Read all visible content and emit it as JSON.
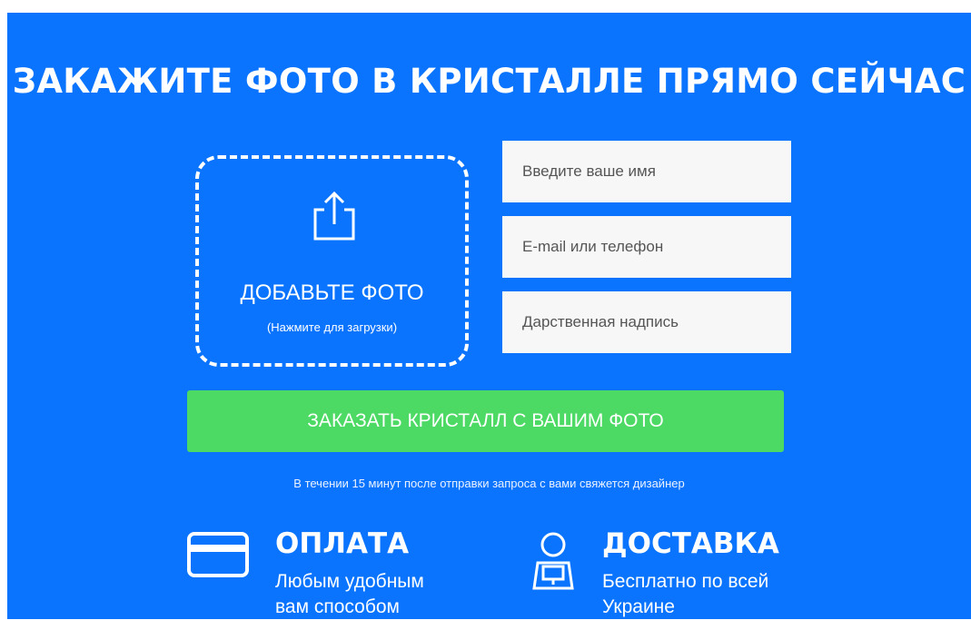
{
  "title": "ЗАКАЖИТЕ ФОТО В КРИСТАЛЛЕ ПРЯМО СЕЙЧАС",
  "upload": {
    "icon": "upload-icon",
    "label": "ДОБАВЬТЕ ФОТО",
    "hint": "(Нажмите для загрузки)"
  },
  "form": {
    "name_placeholder": "Введите ваше имя",
    "contact_placeholder": "E-mail или телефон",
    "inscription_placeholder": "Дарственная надпись"
  },
  "order_button": "ЗАКАЗАТЬ КРИСТАЛЛ С ВАШИМ ФОТО",
  "note": "В течении 15 минут после отправки запроса с вами свяжется дизайнер",
  "features": {
    "payment": {
      "icon": "credit-card-icon",
      "title": "ОПЛАТА",
      "desc_line1": "Любым удобным",
      "desc_line2": "вам способом"
    },
    "delivery": {
      "icon": "courier-icon",
      "title": "ДОСТАВКА",
      "desc_line1": "Бесплатно по всей",
      "desc_line2": "Украине"
    }
  },
  "colors": {
    "background": "#0a74ff",
    "button": "#4cd964",
    "field": "#f7f7f7"
  }
}
